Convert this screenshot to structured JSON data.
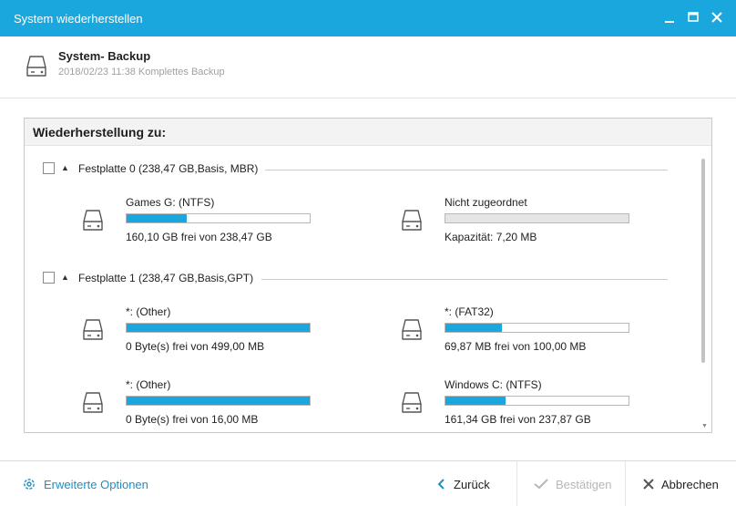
{
  "window": {
    "title": "System wiederherstellen"
  },
  "backup": {
    "name": "System- Backup",
    "meta": "2018/02/23 11:38 Komplettes Backup"
  },
  "restore": {
    "heading": "Wiederherstellung zu:",
    "disks": [
      {
        "label": "Festplatte 0 (238,47 GB,Basis, MBR)",
        "partitions": [
          {
            "name": "Games G: (NTFS)",
            "info": "160,10 GB frei von 238,47 GB",
            "used_fraction": 0.33
          },
          {
            "name": "Nicht zugeordnet",
            "info": "Kapazität: 7,20 MB",
            "used_fraction": 0
          }
        ]
      },
      {
        "label": "Festplatte 1 (238,47 GB,Basis,GPT)",
        "partitions": [
          {
            "name": "*: (Other)",
            "info": "0 Byte(s) frei von 499,00 MB",
            "used_fraction": 1.0
          },
          {
            "name": "*: (FAT32)",
            "info": "69,87 MB frei von 100,00 MB",
            "used_fraction": 0.31
          },
          {
            "name": "*: (Other)",
            "info": "0 Byte(s) frei von 16,00 MB",
            "used_fraction": 1.0
          },
          {
            "name": "Windows C: (NTFS)",
            "info": "161,34 GB frei von 237,87 GB",
            "used_fraction": 0.33
          }
        ]
      }
    ]
  },
  "footer": {
    "advanced_label": "Erweiterte Optionen",
    "back_label": "Zurück",
    "confirm_label": "Bestätigen",
    "cancel_label": "Abbrechen"
  },
  "colors": {
    "accent": "#1aa7dd",
    "link": "#1d8fc6",
    "disabled": "#b7b7b7"
  },
  "icons": {
    "drive": "hard-drive-icon",
    "minimize": "minimize-icon",
    "maximize": "maximize-icon",
    "close": "close-icon",
    "settings": "gear-icon",
    "back": "chevron-left-icon",
    "confirm": "checkmark-icon",
    "cancel": "x-icon",
    "expand": "triangle-icon"
  }
}
